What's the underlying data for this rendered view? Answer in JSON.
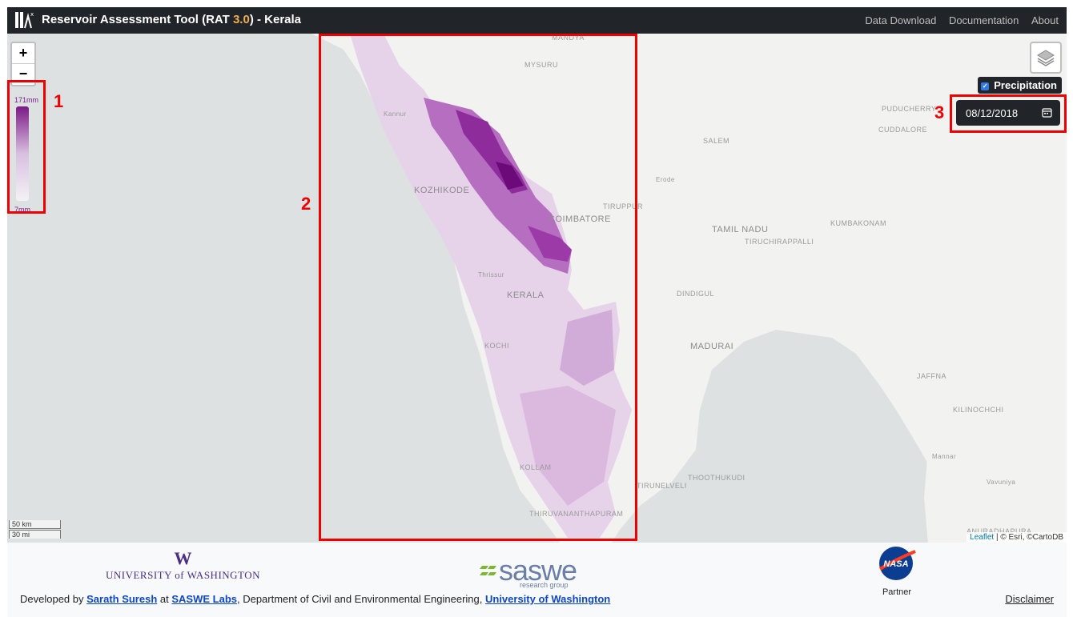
{
  "header": {
    "title_prefix": "Reservoir Assessment Tool (RAT ",
    "version": "3.0",
    "title_suffix": ") - Kerala",
    "links": [
      "Data Download",
      "Documentation",
      "About"
    ]
  },
  "map": {
    "zoom_in": "+",
    "zoom_out": "−",
    "legend": {
      "max": "171mm",
      "min": "7mm",
      "color_high": "#7a1a86",
      "color_low": "#f4f2f6"
    },
    "annotations": [
      "1",
      "2",
      "3"
    ],
    "layer_toggle": {
      "label": "Precipitation",
      "checked": true
    },
    "date_value": "08/12/2018",
    "place_labels": {
      "mandya": "MANDYA",
      "mysuru": "MYSURU",
      "kannur": "Kannur",
      "kozhikode": "KOZHIKODE",
      "coimbatore": "COIMBATORE",
      "tiruppur": "TIRUPPUR",
      "thrissur": "Thrissur",
      "kerala": "KERALA",
      "kochi": "KOCHI",
      "kollam": "KOLLAM",
      "thiruvananthapuram": "THIRUVANANTHAPURAM",
      "tirunelveli": "TIRUNELVELI",
      "thoothukudi": "THOOTHUKUDI",
      "madurai": "MADURAI",
      "dindigul": "DINDIGUL",
      "tamil_nadu": "TAMIL NADU",
      "tiruchirappalli": "TIRUCHIRAPPALLI",
      "kumbakonam": "KUMBAKONAM",
      "salem": "SALEM",
      "erode": "Erode",
      "puducherry": "PUDUCHERRY",
      "cuddalore": "CUDDALORE",
      "jaffna": "JAFFNA",
      "kilinochchi": "KILINOCHCHI",
      "mannar": "Mannar",
      "vavuniya": "Vavuniya",
      "anuradhapura": "ANURADHAPURA"
    },
    "scale": {
      "km": "50 km",
      "mi": "30 mi"
    },
    "attribution": {
      "leaflet": "Leaflet",
      "rest": " | © Esri, ©CartoDB"
    }
  },
  "footer": {
    "uw_mark": "W",
    "uw_name": "UNIVERSITY of WASHINGTON",
    "saswe_name": "saswe",
    "saswe_sub": "research group",
    "nasa_label": "Partner",
    "nasa_logo_text": "NASA",
    "dev_prefix": "Developed by ",
    "dev_name": "Sarath Suresh",
    "dev_at": " at ",
    "dev_lab": "SASWE Labs",
    "dev_mid": ", Department of Civil and Environmental Engineering, ",
    "dev_univ": "University of Washington",
    "disclaimer": "Disclaimer"
  }
}
